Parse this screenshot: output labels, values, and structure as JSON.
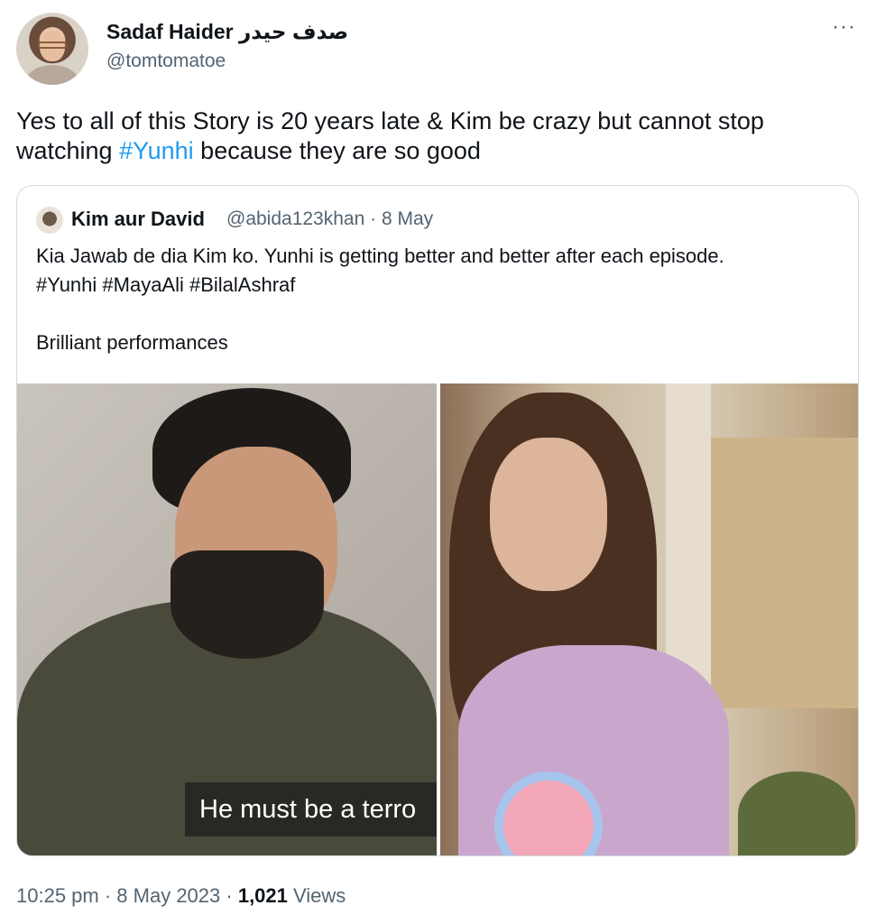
{
  "tweet": {
    "display_name": "Sadaf Haider صدف حیدر",
    "handle": "@tomtomatoe",
    "more_label": "···",
    "text_before": "Yes to all of this Story is 20 years late & Kim be crazy but cannot stop watching ",
    "hashtag": "#Yunhi",
    "text_after": " because they are so good",
    "time": "10:25 pm",
    "sep1": " · ",
    "date": "8 May 2023",
    "sep2": " · ",
    "views_count": "1,021",
    "views_label": " Views"
  },
  "quote": {
    "display_name": "Kim aur David",
    "handle_and_date": "@abida123khan · 8 May",
    "line1": "Kia Jawab de dia Kim ko. Yunhi is getting better and better after each episode.",
    "line2": "#Yunhi #MayaAli #BilalAshraf",
    "line3": "",
    "line4": "Brilliant performances",
    "media": {
      "left_subtitle": "He must be a terro"
    }
  }
}
